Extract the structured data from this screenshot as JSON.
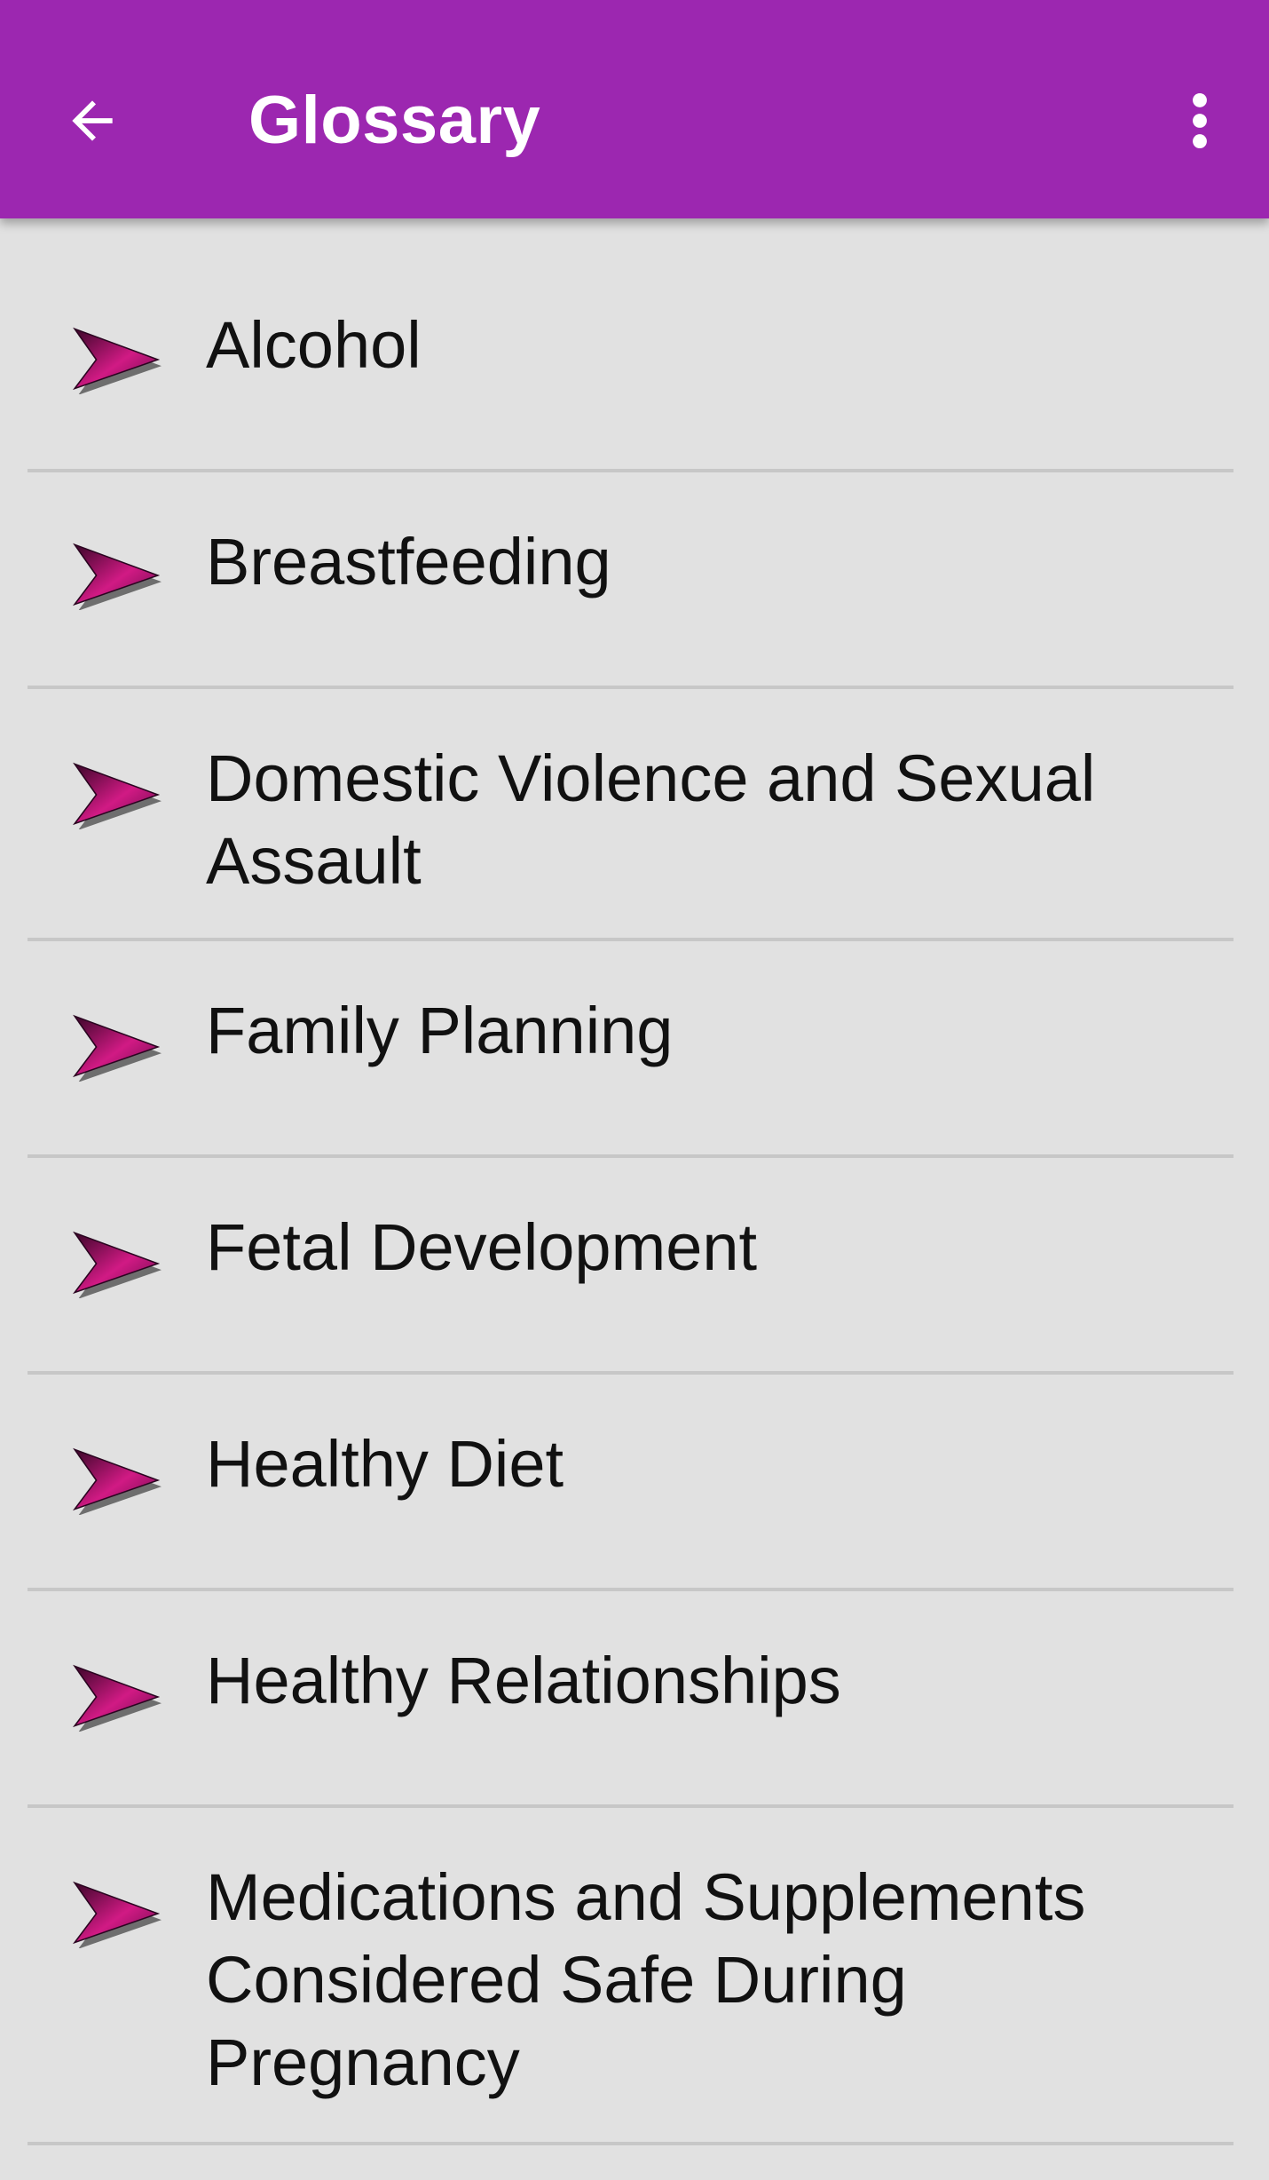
{
  "app_bar": {
    "title": "Glossary",
    "back_icon": "arrow-left-icon",
    "menu_icon": "more-vertical-icon",
    "background_color": "#9c27b0"
  },
  "list": {
    "bullet_icon": "pink-arrow-bullet-icon",
    "items": [
      {
        "label": "Alcohol"
      },
      {
        "label": "Breastfeeding"
      },
      {
        "label": "Domestic Violence and Sexual Assault"
      },
      {
        "label": "Family Planning"
      },
      {
        "label": "Fetal Development"
      },
      {
        "label": "Healthy Diet"
      },
      {
        "label": "Healthy Relationships"
      },
      {
        "label": "Medications and Supplements Considered Safe During Pregnancy"
      }
    ]
  },
  "colors": {
    "background": "#e1e1e1",
    "divider": "#c7c7c7",
    "text": "#111111",
    "arrow_pink": "#c2127a"
  }
}
